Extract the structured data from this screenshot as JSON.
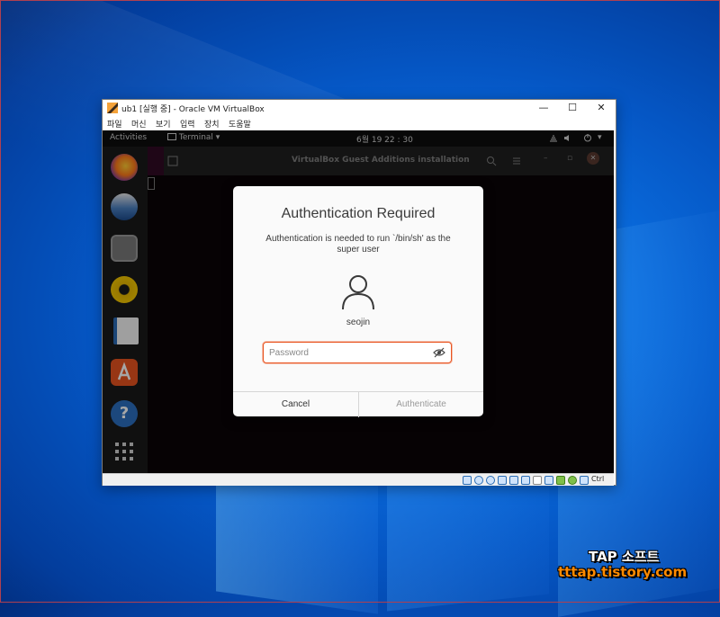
{
  "window": {
    "title": "ub1 [실행 중] - Oracle VM VirtualBox",
    "minimize": "—",
    "maximize": "☐",
    "close": "✕"
  },
  "menu": [
    "파일",
    "머신",
    "보기",
    "입력",
    "장치",
    "도움말"
  ],
  "gnome": {
    "activities": "Activities",
    "app_menu": "Terminal ▾",
    "clock": "6월 19  22 : 30",
    "terminal_title": "VirtualBox Guest Additions installation"
  },
  "dialog": {
    "title": "Authentication Required",
    "message": "Authentication is needed to run `/bin/sh' as the super user",
    "username": "seojin",
    "password_placeholder": "Password",
    "cancel_label": "Cancel",
    "authenticate_label": "Authenticate"
  },
  "statusbar": {
    "host_key": "Ctrl"
  },
  "watermark": {
    "title": "TAP 소프트",
    "url": "tttap.tistory.com"
  },
  "colors": {
    "accent": "#e95420",
    "desktop": "#0a6ee0",
    "terminal_bg": "#300a24"
  },
  "icons": [
    "firefox-icon",
    "thunderbird-icon",
    "files-icon",
    "rhythmbox-icon",
    "libreoffice-writer-icon",
    "software-icon",
    "help-icon",
    "show-apps-icon"
  ]
}
